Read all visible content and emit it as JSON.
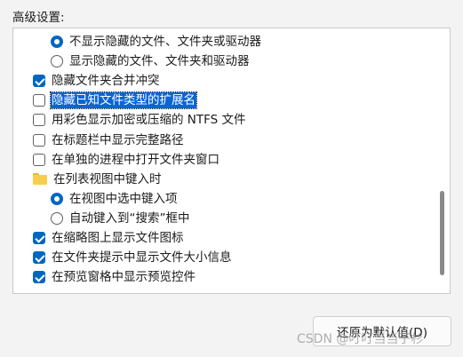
{
  "section_label": "高级设置:",
  "tree": {
    "items": [
      {
        "kind": "radio",
        "checked": true,
        "label": "不显示隐藏的文件、文件夹或驱动器",
        "indent": 1
      },
      {
        "kind": "radio",
        "checked": false,
        "label": "显示隐藏的文件、文件夹和驱动器",
        "indent": 1
      },
      {
        "kind": "checkbox",
        "checked": true,
        "label": "隐藏文件夹合并冲突",
        "indent": 0
      },
      {
        "kind": "checkbox",
        "checked": false,
        "label": "隐藏已知文件类型的扩展名",
        "indent": 0,
        "selected": true
      },
      {
        "kind": "checkbox",
        "checked": false,
        "label": "用彩色显示加密或压缩的 NTFS 文件",
        "indent": 0
      },
      {
        "kind": "checkbox",
        "checked": false,
        "label": "在标题栏中显示完整路径",
        "indent": 0
      },
      {
        "kind": "checkbox",
        "checked": false,
        "label": "在单独的进程中打开文件夹窗口",
        "indent": 0
      },
      {
        "kind": "folder",
        "label": "在列表视图中键入时",
        "indent": 0
      },
      {
        "kind": "radio",
        "checked": true,
        "label": "在视图中选中键入项",
        "indent": 1
      },
      {
        "kind": "radio",
        "checked": false,
        "label": "自动键入到“搜索”框中",
        "indent": 1
      },
      {
        "kind": "checkbox",
        "checked": true,
        "label": "在缩略图上显示文件图标",
        "indent": 0
      },
      {
        "kind": "checkbox",
        "checked": true,
        "label": "在文件夹提示中显示文件大小信息",
        "indent": 0
      },
      {
        "kind": "checkbox",
        "checked": true,
        "label": "在预览窗格中显示预览控件",
        "indent": 0
      }
    ]
  },
  "restore_button_label": "还原为默认值(D)",
  "watermark": "CSDN @叮叮当当子杉",
  "colors": {
    "accent": "#0067c0",
    "selection": "#0a64d8",
    "folder": "#f8cd4f"
  }
}
